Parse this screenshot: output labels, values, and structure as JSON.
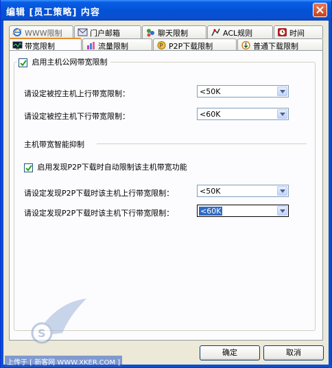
{
  "window": {
    "title": "编辑 [员工策略] 内容"
  },
  "tabs_row1": [
    {
      "label": "WWW限制",
      "icon": "ie-icon"
    },
    {
      "label": "门户邮箱",
      "icon": "mail-icon"
    },
    {
      "label": "聊天限制",
      "icon": "chat-icon"
    },
    {
      "label": "ACL规则",
      "icon": "acl-icon"
    },
    {
      "label": "时间",
      "icon": "clock-icon"
    }
  ],
  "tabs_row2": [
    {
      "label": "带宽限制",
      "icon": "monitor-icon",
      "active": true
    },
    {
      "label": "流量限制",
      "icon": "bar-chart-icon"
    },
    {
      "label": "P2P下载限制",
      "icon": "p2p-icon"
    },
    {
      "label": "普通下载限制",
      "icon": "download-icon"
    }
  ],
  "bandwidth": {
    "enable_label": "启用主机公网带宽限制",
    "enable_checked": true,
    "upload_label": "请设定被控主机上行带宽限制：",
    "upload_value": "<50K",
    "download_label": "请设定被控主机下行带宽限制：",
    "download_value": "<60K",
    "smart_section": "主机带宽智能抑制",
    "p2p_enable_label": "启用发现P2P下载时自动限制该主机带宽功能",
    "p2p_enable_checked": true,
    "p2p_upload_label": "请设定发现P2P下载时该主机上行带宽限制：",
    "p2p_upload_value": "<50K",
    "p2p_download_label": "请设定发现P2P下载时该主机下行带宽限制：",
    "p2p_download_value": "<60K"
  },
  "buttons": {
    "ok": "确定",
    "cancel": "取消"
  },
  "watermark": {
    "text": "上传于 [ 新客网 WWW.XKER.COM ]"
  },
  "colors": {
    "title_blue": "#0352d6",
    "tab_accent": "#e68b2c",
    "selection": "#316ac5"
  }
}
